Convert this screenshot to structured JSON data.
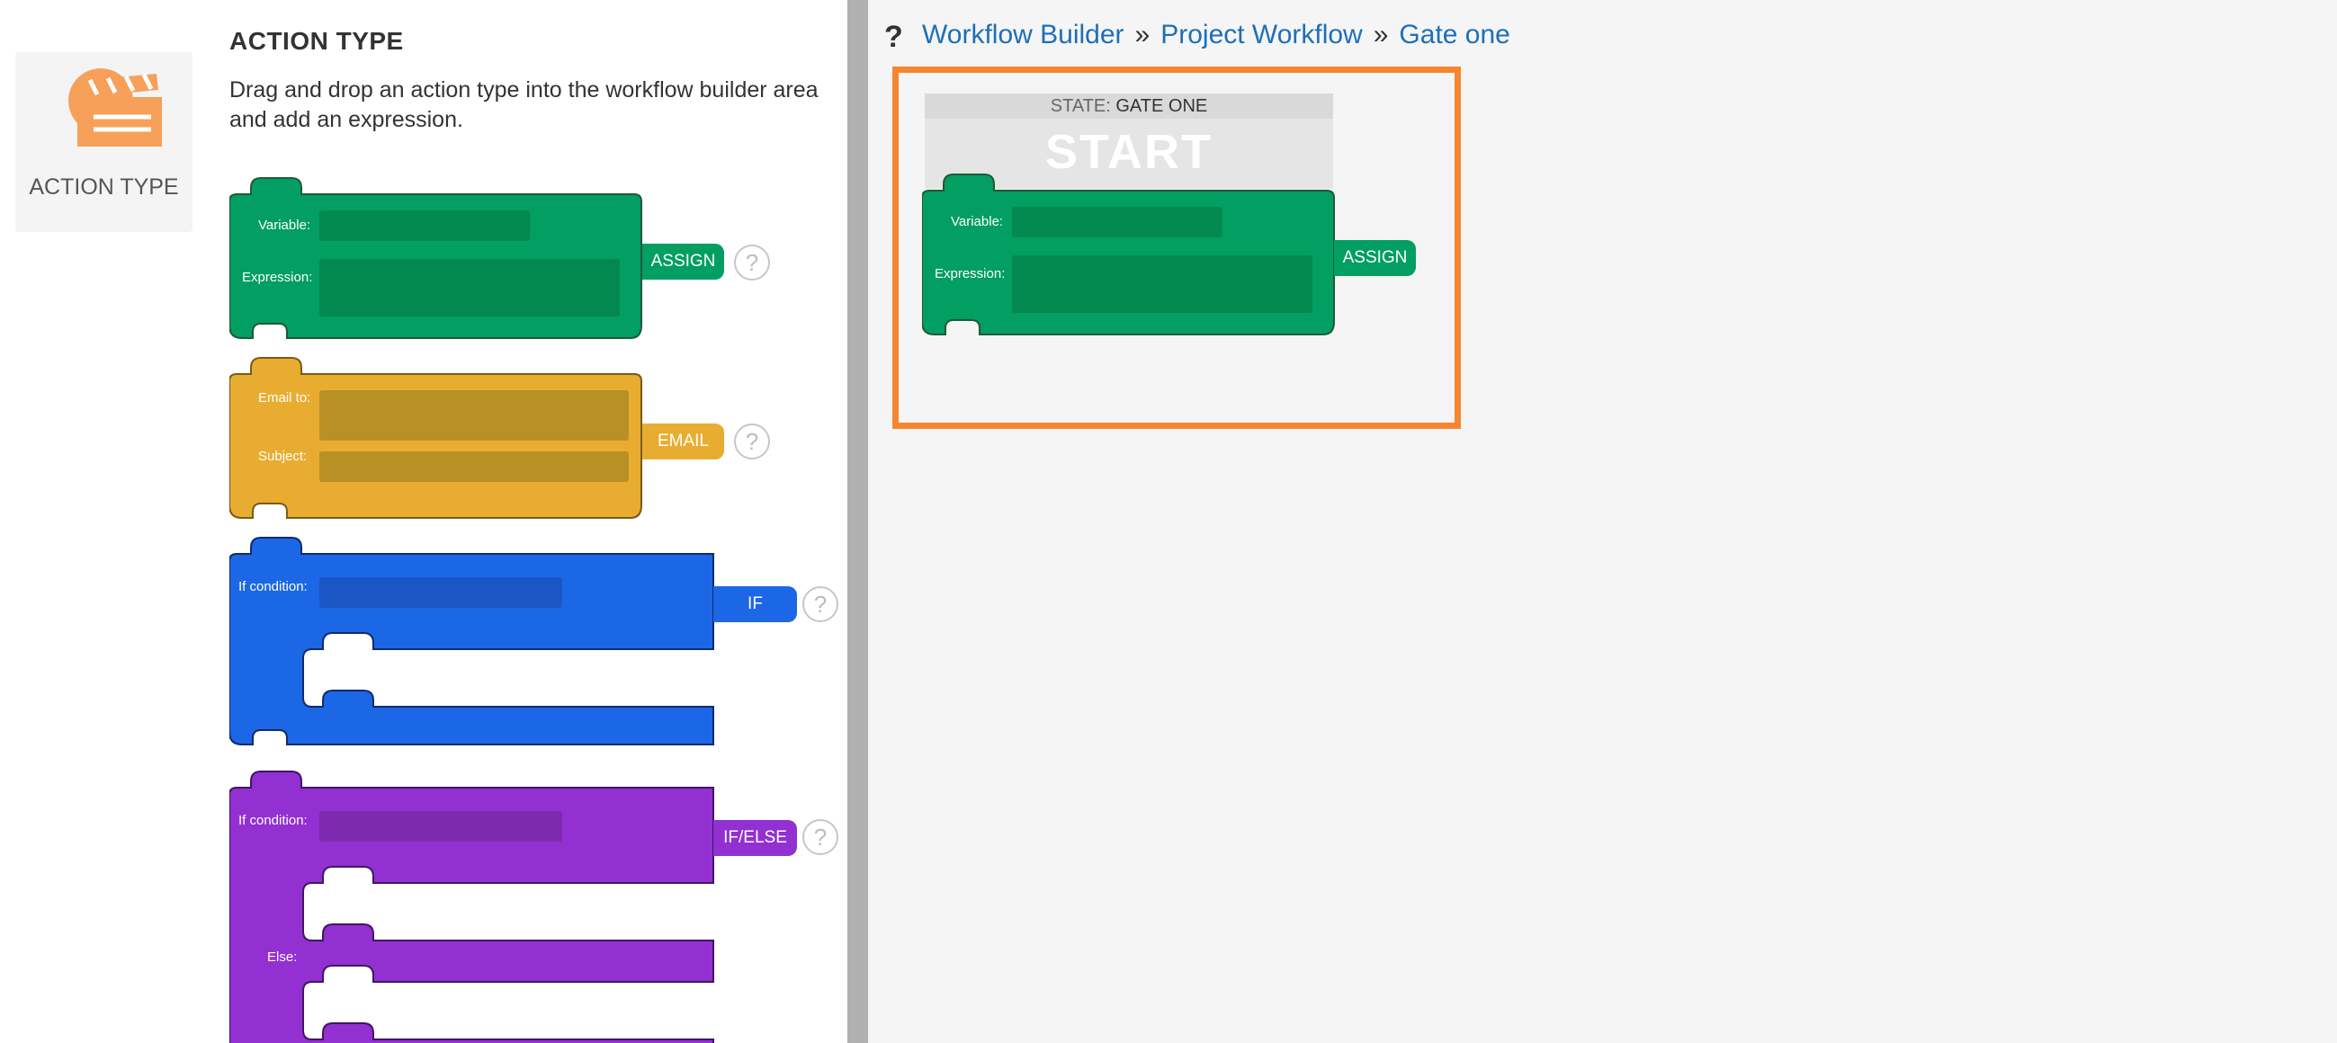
{
  "sidebar": {
    "action_type_label": "ACTION TYPE",
    "icon": "clapperboard-icon"
  },
  "palette": {
    "title": "ACTION TYPE",
    "description": "Drag and drop an action type into the workflow builder area and add an expression.",
    "blocks": {
      "assign": {
        "variable_label": "Variable:",
        "expression_label": "Expression:",
        "tag": "ASSIGN",
        "help": "?"
      },
      "email": {
        "email_to_label": "Email to:",
        "subject_label": "Subject:",
        "tag": "EMAIL",
        "help": "?"
      },
      "if": {
        "condition_label": "If condition:",
        "tag": "IF",
        "help": "?"
      },
      "if_else": {
        "condition_label": "If condition:",
        "else_label": "Else:",
        "tag": "IF/ELSE",
        "help": "?"
      }
    }
  },
  "header": {
    "help_mark": "?",
    "breadcrumb": [
      "Workflow Builder",
      "Project Workflow",
      "Gate one"
    ],
    "separator": "»"
  },
  "canvas": {
    "state_prefix": "STATE:",
    "state_name": "GATE ONE",
    "start_label": "START",
    "block": {
      "variable_label": "Variable:",
      "expression_label": "Expression:",
      "tag": "ASSIGN"
    }
  },
  "colors": {
    "assign": "#029e62",
    "email": "#e8ad30",
    "if": "#1c67e6",
    "if_else": "#9230d2",
    "accent": "#f68630",
    "link": "#1d6fb8"
  }
}
